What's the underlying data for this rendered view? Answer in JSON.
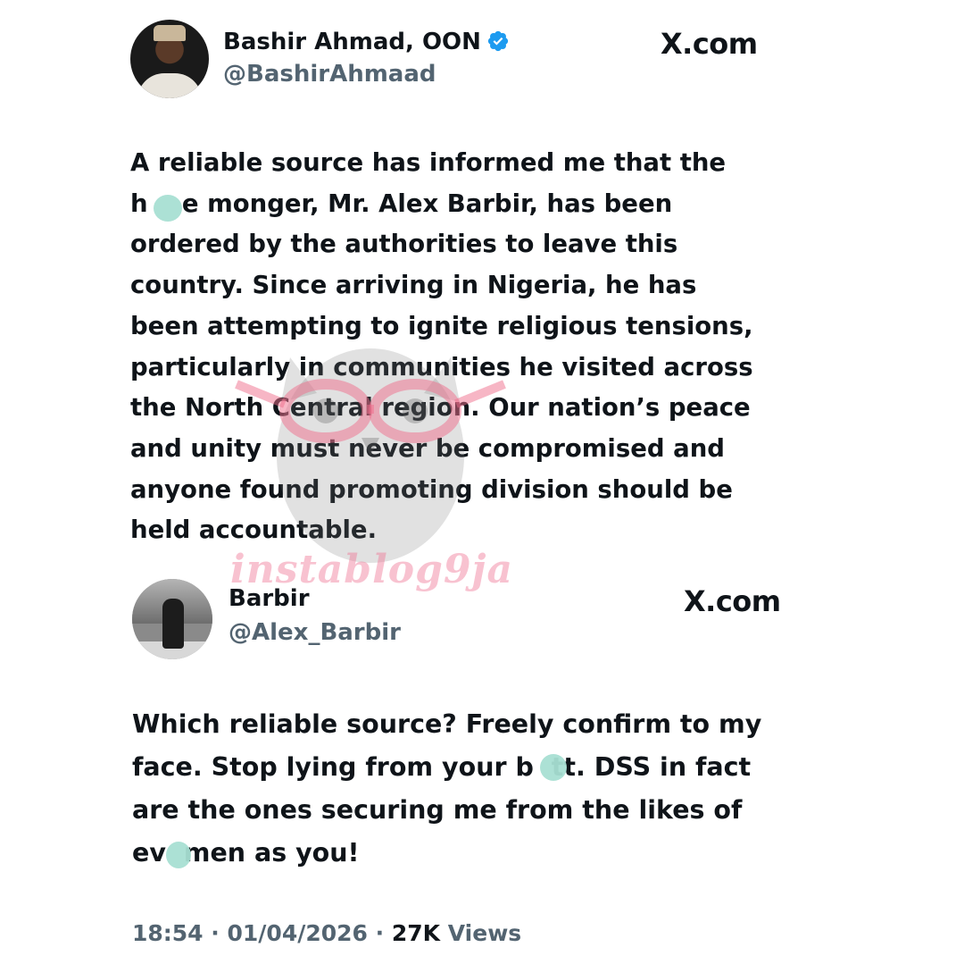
{
  "tweet1": {
    "author_name": "Bashir Ahmad, OON",
    "handle": "@BashirAhmaad",
    "verified": true,
    "site": "X.com",
    "lines": [
      "A reliable source has informed me that the",
      "h    e monger, Mr. Alex Barbir, has been",
      "ordered by the authorities to leave this",
      "country. Since arriving in Nigeria, he has",
      "been attempting to ignite religious tensions,",
      "particularly in communities he visited across",
      "the North Central region. Our nation’s peace",
      "and unity must never be compromised and",
      "anyone found promoting division should be",
      "held accountable."
    ]
  },
  "tweet2": {
    "author_name": "Barbir",
    "handle": "@Alex_Barbir",
    "site": "X.com",
    "lines": [
      "Which reliable source? Freely confirm to my",
      "face. Stop lying from your b  tt. DSS in fact",
      "are the ones securing me from the likes of",
      "ev  men as you!"
    ],
    "time": "18:54",
    "date": "01/04/2026",
    "separator": "·",
    "views_count": "27K",
    "views_label": "Views"
  },
  "watermark": {
    "text": "instablog9ja",
    "color": "#f07896"
  },
  "colors": {
    "text_primary": "#0f1419",
    "text_secondary": "#536471",
    "verified_blue": "#1d9bf0",
    "censor_smudge": "#a8dfd3"
  },
  "icons": {
    "verified": "verified-badge-icon",
    "logo": "x-logo-icon"
  }
}
